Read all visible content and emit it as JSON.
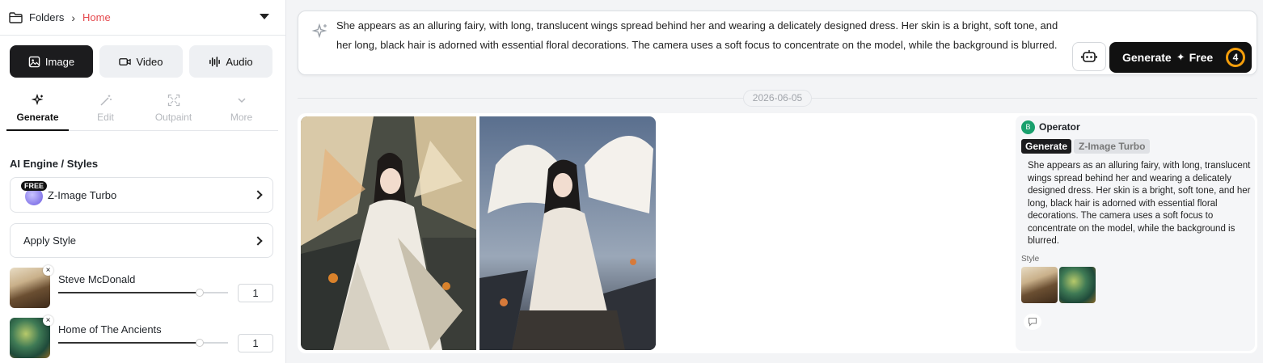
{
  "breadcrumb": {
    "folders_label": "Folders",
    "current": "Home"
  },
  "media_tabs": [
    {
      "label": "Image",
      "icon": "image-icon",
      "active": true
    },
    {
      "label": "Video",
      "icon": "video-icon",
      "active": false
    },
    {
      "label": "Audio",
      "icon": "audio-wave-icon",
      "active": false
    }
  ],
  "mode_tabs": [
    {
      "label": "Generate",
      "icon": "sparkle-icon",
      "active": true
    },
    {
      "label": "Edit",
      "icon": "magic-wand-icon",
      "active": false
    },
    {
      "label": "Outpaint",
      "icon": "expand-icon",
      "active": false
    },
    {
      "label": "More",
      "icon": "chevron-down-icon",
      "active": false
    }
  ],
  "engine_section": {
    "title": "AI Engine / Styles",
    "engine": {
      "name": "Z-Image Turbo",
      "badge": "FREE"
    },
    "apply_style_label": "Apply Style"
  },
  "styles": [
    {
      "name": "Steve McDonald",
      "strength": 1,
      "slider_fraction": 0.83
    },
    {
      "name": "Home of The Ancients",
      "strength": 1,
      "slider_fraction": 0.83
    }
  ],
  "prompt": {
    "text": "She appears as an alluring fairy, with long, translucent wings spread behind her and wearing a delicately designed dress. Her skin is a bright, soft tone, and her long, black hair is adorned with essential floral decorations. The camera uses a soft focus to concentrate on the model, while the background is blurred.",
    "generate_label": "Generate",
    "free_label": "Free",
    "credits": "4"
  },
  "date": "2026-06-05",
  "result": {
    "operator_initial": "B",
    "operator_name": "Operator",
    "mode_tag": "Generate",
    "model_tag": "Z-Image Turbo",
    "prompt": "She appears as an alluring fairy, with long, translucent wings spread behind her and wearing a delicately designed dress. Her skin is a bright, soft tone, and her long, black hair is adorned with essential floral decorations. The camera uses a soft focus to concentrate on the model, while the background is blurred.",
    "style_label": "Style"
  },
  "colors": {
    "accent_red": "#e5484d",
    "dark": "#1c1c1e",
    "credit_ring": "#f59e0b",
    "operator_green": "#1aa06d"
  }
}
